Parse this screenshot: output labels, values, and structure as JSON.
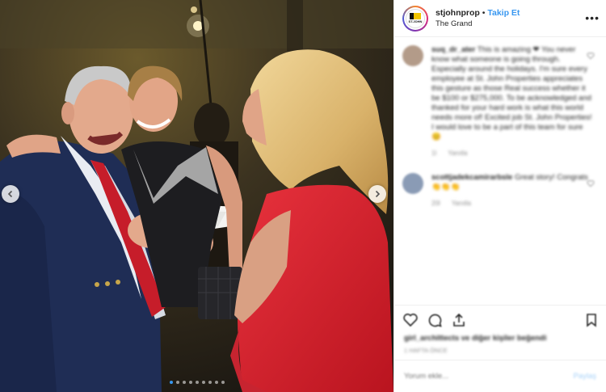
{
  "header": {
    "username": "stjohnprop",
    "separator": "•",
    "follow_label": "Takip Et",
    "location": "The Grand",
    "more_icon": "more-horizontal-icon",
    "logo_text": "ST.JOHN"
  },
  "media": {
    "slide_count": 9,
    "active_slide": 1,
    "prev_icon": "chevron-left-icon",
    "next_icon": "chevron-right-icon"
  },
  "comments": [
    {
      "username": "suq_dr_ater",
      "text": "This is amazing ❤ You never know what someone is going through. Especially around the holidays. I'm sure every employee at St. John Properties appreciates this gesture as those Real success whether it be $100 or $275,000. To be acknowledged and thanked for your hard work is what this world needs more of! Excited job St. John Properties! I would love to be a part of this team for sure 😊",
      "meta_likes": "1l",
      "meta_reply": "Yanıtla"
    },
    {
      "username": "scottjadekcamirarbsle",
      "text": "Great story! Congrats 👏👏👏",
      "meta_likes": "20l",
      "meta_reply": "Yanıtla"
    }
  ],
  "actions": {
    "like_icon": "heart-icon",
    "comment_icon": "comment-icon",
    "share_icon": "share-icon",
    "save_icon": "bookmark-icon"
  },
  "likes_text": "girl_archittects ve diğer kişiler beğendi",
  "timestamp": "1 hafta önce",
  "add_comment": {
    "placeholder": "Yorum ekle...",
    "post_label": "Paylaş"
  },
  "colors": {
    "accent": "#3897f0",
    "text": "#262626",
    "muted": "#8e8e8e",
    "border": "#efefef"
  }
}
